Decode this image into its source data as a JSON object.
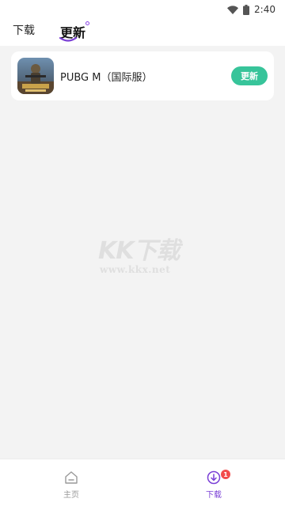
{
  "status_bar": {
    "time": "2:40",
    "icons": [
      "wifi-icon",
      "battery-icon"
    ]
  },
  "tabs": [
    {
      "label": "下载",
      "active": false
    },
    {
      "label": "更新",
      "active": true
    }
  ],
  "update_list": [
    {
      "name": "PUBG M（国际服）",
      "button": "更新",
      "icon": "pubg-app-icon"
    }
  ],
  "watermark": {
    "title": "KK下载",
    "url": "www.kkx.net"
  },
  "bottom_nav": [
    {
      "label": "主页",
      "icon": "home-icon",
      "active": false
    },
    {
      "label": "下载",
      "icon": "download-icon",
      "active": true,
      "badge": "1"
    }
  ],
  "colors": {
    "accent": "#7a3fd6",
    "update_button": "#37c49a",
    "badge": "#f24c4c",
    "background": "#f3f3f3"
  }
}
